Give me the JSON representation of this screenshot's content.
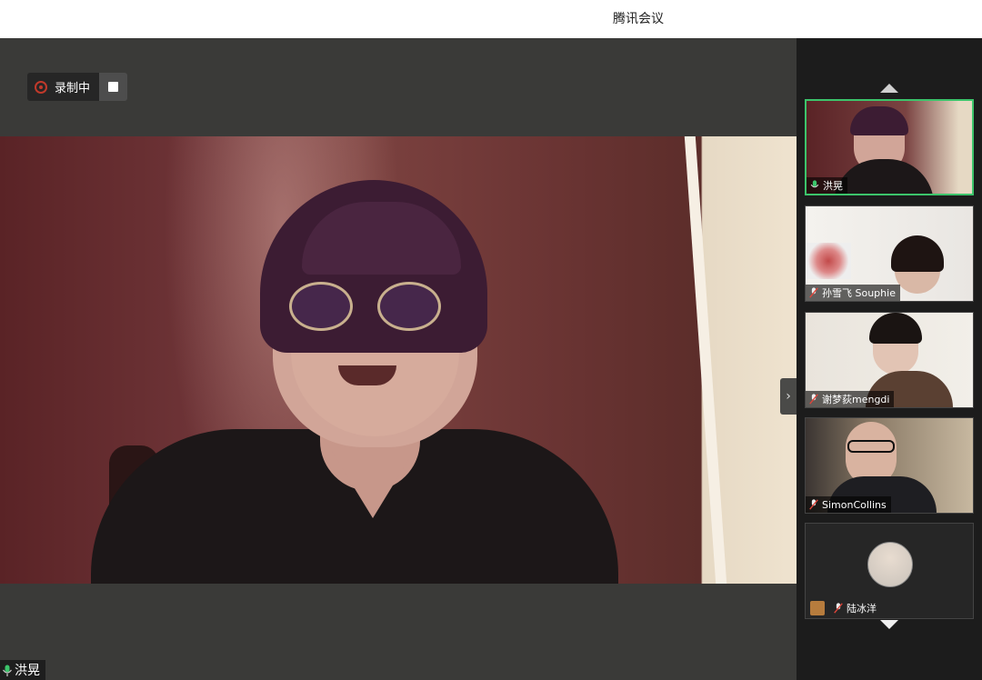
{
  "window": {
    "title": "腾讯会议"
  },
  "recording": {
    "label": "录制中"
  },
  "main_speaker": {
    "name": "洪晃"
  },
  "participants": [
    {
      "name": "洪晃",
      "mic": "on",
      "active": true
    },
    {
      "name": "孙雪飞 Souphie",
      "mic": "muted"
    },
    {
      "name": "谢梦荻mengdi",
      "mic": "muted"
    },
    {
      "name": "SimonCollins",
      "mic": "muted"
    },
    {
      "name": "陆冰洋",
      "mic": "muted",
      "video": "off"
    }
  ],
  "colors": {
    "active_border": "#3cc46b",
    "record_red": "#c0392b",
    "background": "#3a3a38",
    "sidebar": "#1c1c1c"
  }
}
